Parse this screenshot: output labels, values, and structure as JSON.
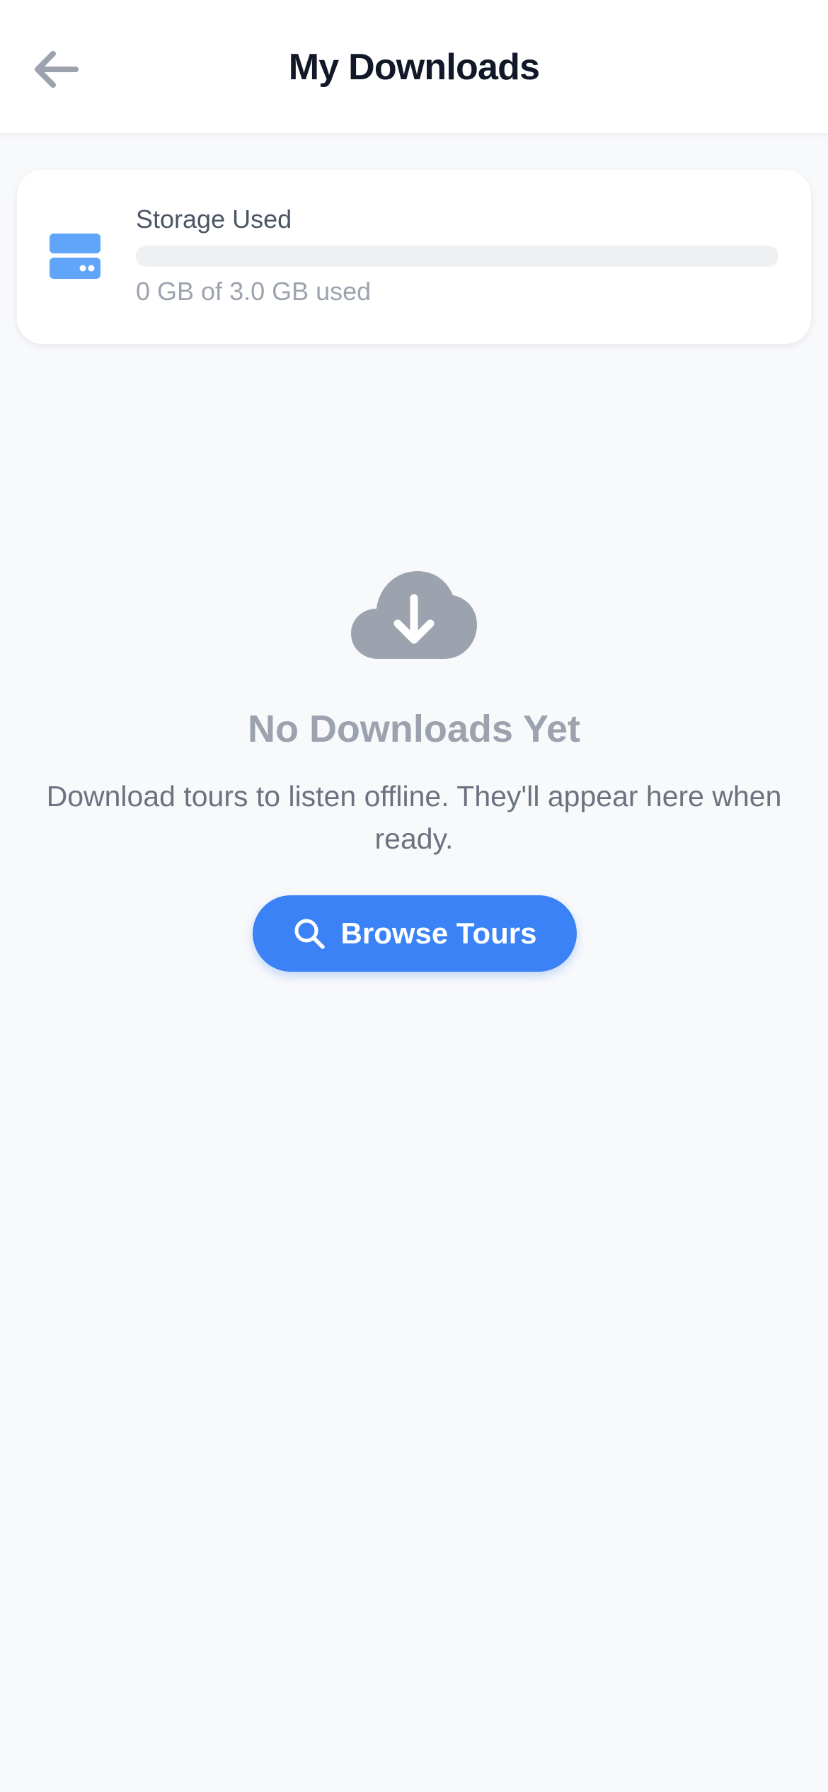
{
  "header": {
    "title": "My Downloads",
    "back_icon": "arrow-left-icon"
  },
  "storage": {
    "label": "Storage Used",
    "used_text": "0 GB of 3.0 GB used",
    "used_fraction": 0,
    "icon": "hard-drive-icon"
  },
  "empty_state": {
    "icon": "cloud-download-icon",
    "title": "No Downloads Yet",
    "description": "Download tours to listen offline. They'll appear here when ready.",
    "button_label": "Browse Tours",
    "button_icon": "search-icon"
  },
  "colors": {
    "accent": "#3B82F6",
    "icon_light_blue": "#60A5FA",
    "muted": "#9CA3AF",
    "background": "#F8F9FB"
  }
}
